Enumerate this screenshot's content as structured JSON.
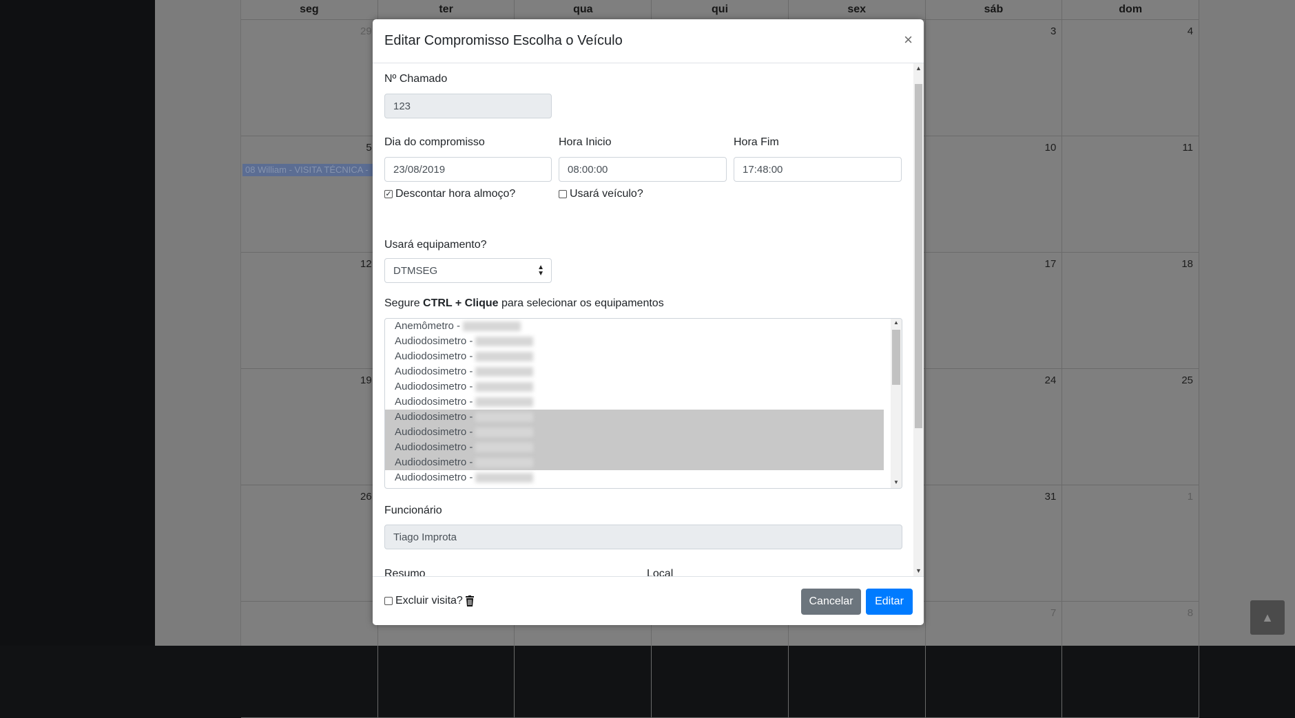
{
  "calendar": {
    "weekdays": [
      "seg",
      "ter",
      "qua",
      "qui",
      "sex",
      "sáb",
      "dom"
    ],
    "rows": [
      [
        "29",
        "",
        "",
        "",
        "",
        "3",
        "4"
      ],
      [
        "5",
        "",
        "",
        "",
        "",
        "10",
        "11"
      ],
      [
        "12",
        "",
        "",
        "",
        "",
        "17",
        "18"
      ],
      [
        "19",
        "",
        "",
        "",
        "",
        "24",
        "25"
      ],
      [
        "26",
        "",
        "",
        "",
        "",
        "31",
        "1"
      ],
      [
        "",
        "",
        "",
        "",
        "",
        "7",
        "8"
      ]
    ],
    "event": "08 William - VISITA TÉCNICA -"
  },
  "modal": {
    "title": "Editar Compromisso Escolha o Veículo",
    "close": "×",
    "chamado_label": "Nº Chamado",
    "chamado_value": "123",
    "dia_label": "Dia do compromisso",
    "dia_value": "23/08/2019",
    "hora_inicio_label": "Hora Inicio",
    "hora_inicio_value": "08:00:00",
    "hora_fim_label": "Hora Fim",
    "hora_fim_value": "17:48:00",
    "descontar_label": "Descontar hora almoço?",
    "descontar_checked": "✓",
    "veiculo_label": "Usará veículo?",
    "equip_label": "Usará equipamento?",
    "equip_value": "DTMSEG",
    "hint_prefix": "Segure ",
    "hint_bold": "CTRL + Clique",
    "hint_suffix": " para selecionar os equipamentos",
    "equipment_items": [
      {
        "name": "Anemômetro -",
        "selected": false
      },
      {
        "name": "Audiodosimetro -",
        "selected": false
      },
      {
        "name": "Audiodosimetro -",
        "selected": false
      },
      {
        "name": "Audiodosimetro -",
        "selected": false
      },
      {
        "name": "Audiodosimetro -",
        "selected": false
      },
      {
        "name": "Audiodosimetro -",
        "selected": false
      },
      {
        "name": "Audiodosimetro -",
        "selected": true
      },
      {
        "name": "Audiodosimetro -",
        "selected": true
      },
      {
        "name": "Audiodosimetro -",
        "selected": true
      },
      {
        "name": "Audiodosimetro -",
        "selected": true
      },
      {
        "name": "Audiodosimetro -",
        "selected": false
      }
    ],
    "funcionario_label": "Funcionário",
    "funcionario_value": "Tiago Improta",
    "resumo_label": "Resumo",
    "local_label": "Local",
    "excluir_label": "Excluir visita?",
    "cancel_label": "Cancelar",
    "edit_label": "Editar"
  },
  "scroll_top_icon": "▲"
}
